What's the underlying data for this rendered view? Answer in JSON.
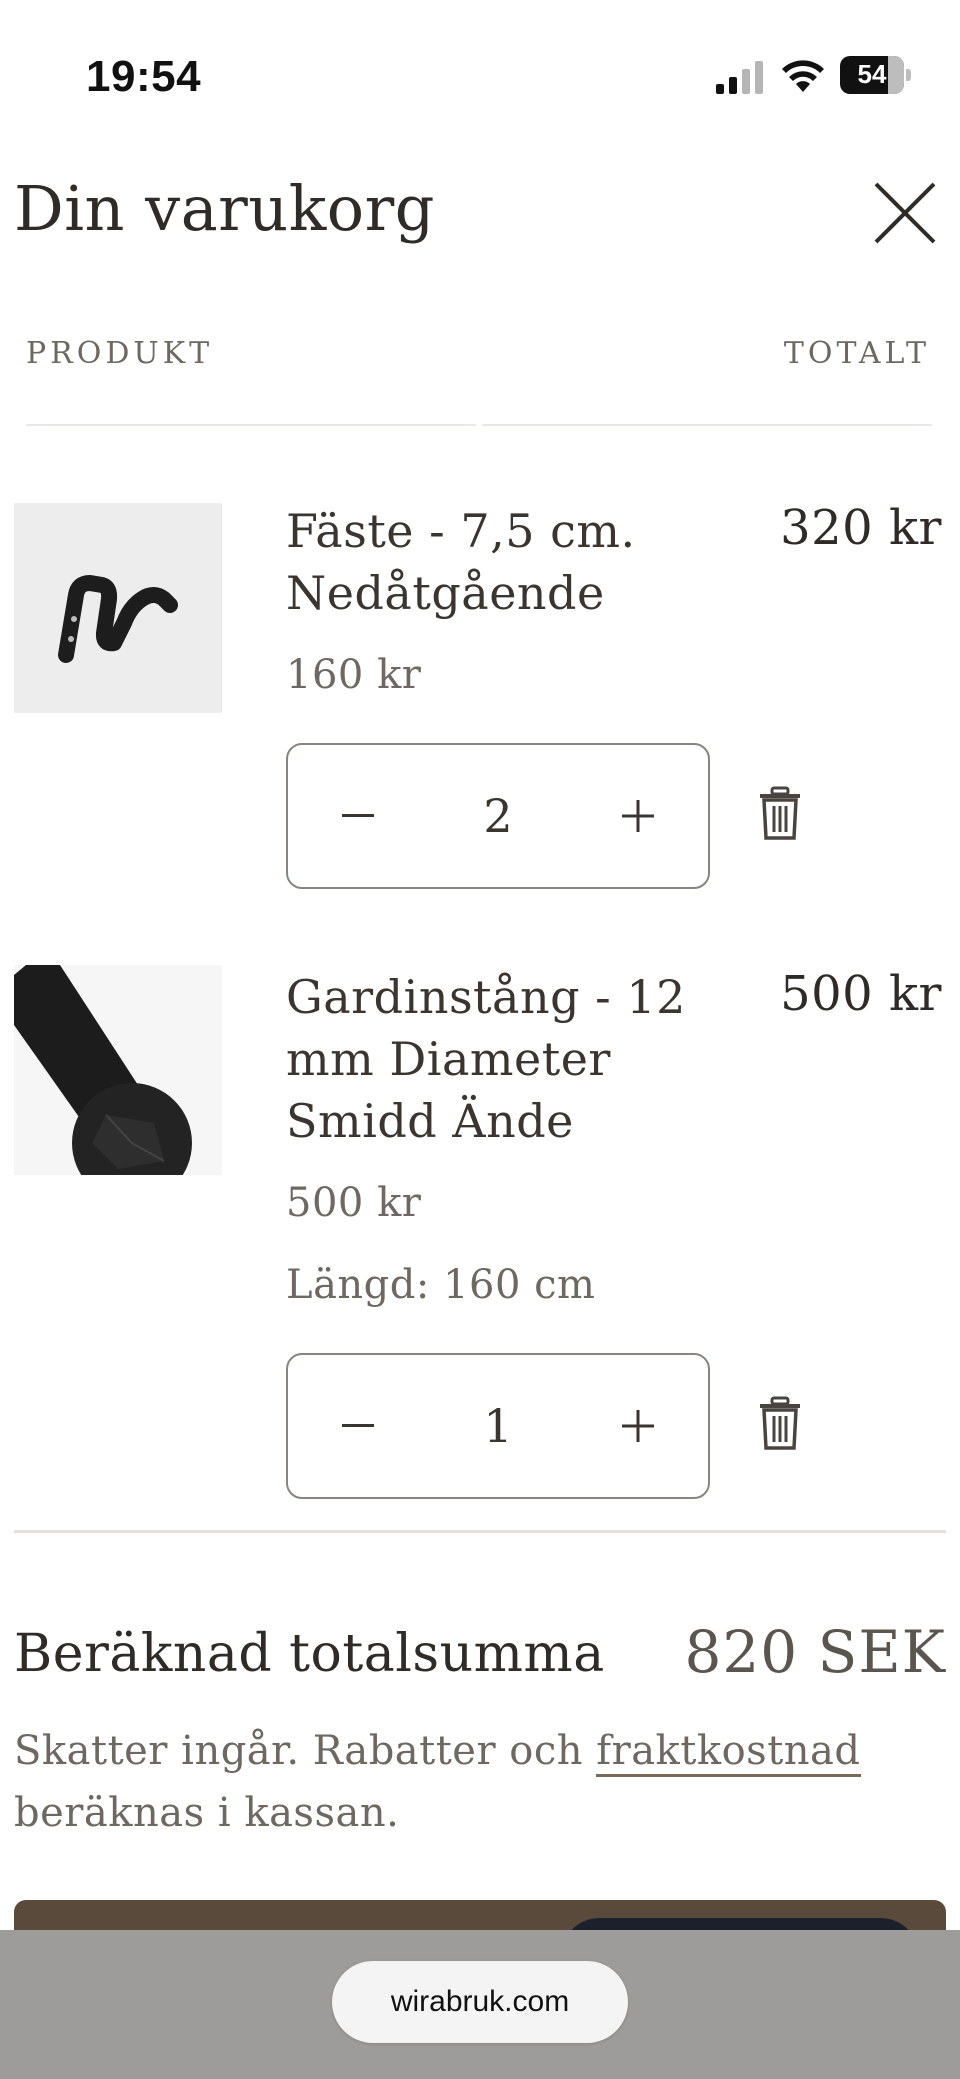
{
  "status_bar": {
    "time": "19:54",
    "battery": "54"
  },
  "cart": {
    "title": "Din varukorg",
    "columns": {
      "product": "PRODUKT",
      "total": "TOTALT"
    },
    "items": [
      {
        "title_line1": "Fäste - 7,5 cm.",
        "title_line2": "Nedåtgående",
        "price": "160 kr",
        "quantity": "2",
        "line_total": "320 kr"
      },
      {
        "title_line1": "Gardinstång - 12",
        "title_line2": "mm Diameter",
        "title_line3": "Smidd Ände",
        "price": "500 kr",
        "length": "Längd: 160 cm",
        "quantity": "1",
        "line_total": "500 kr"
      }
    ],
    "estimated_total_label": "Beräknad totalsumma",
    "estimated_total_value": "820 SEK",
    "tax_note_before": "Skatter ingår. Rabatter och ",
    "tax_note_link": "fraktkostnad",
    "tax_note_after": "beräknas i kassan."
  },
  "browser": {
    "url": "wirabruk.com"
  },
  "colors": {
    "text_dark": "#2f2b28",
    "text_muted": "#6e6862",
    "checkout_brown": "#5a4a3c",
    "browser_bar": "#9d9c9a"
  },
  "icons": [
    "signal-icon",
    "wifi-icon",
    "battery-icon",
    "close-icon",
    "minus-icon",
    "plus-icon",
    "trash-icon"
  ]
}
